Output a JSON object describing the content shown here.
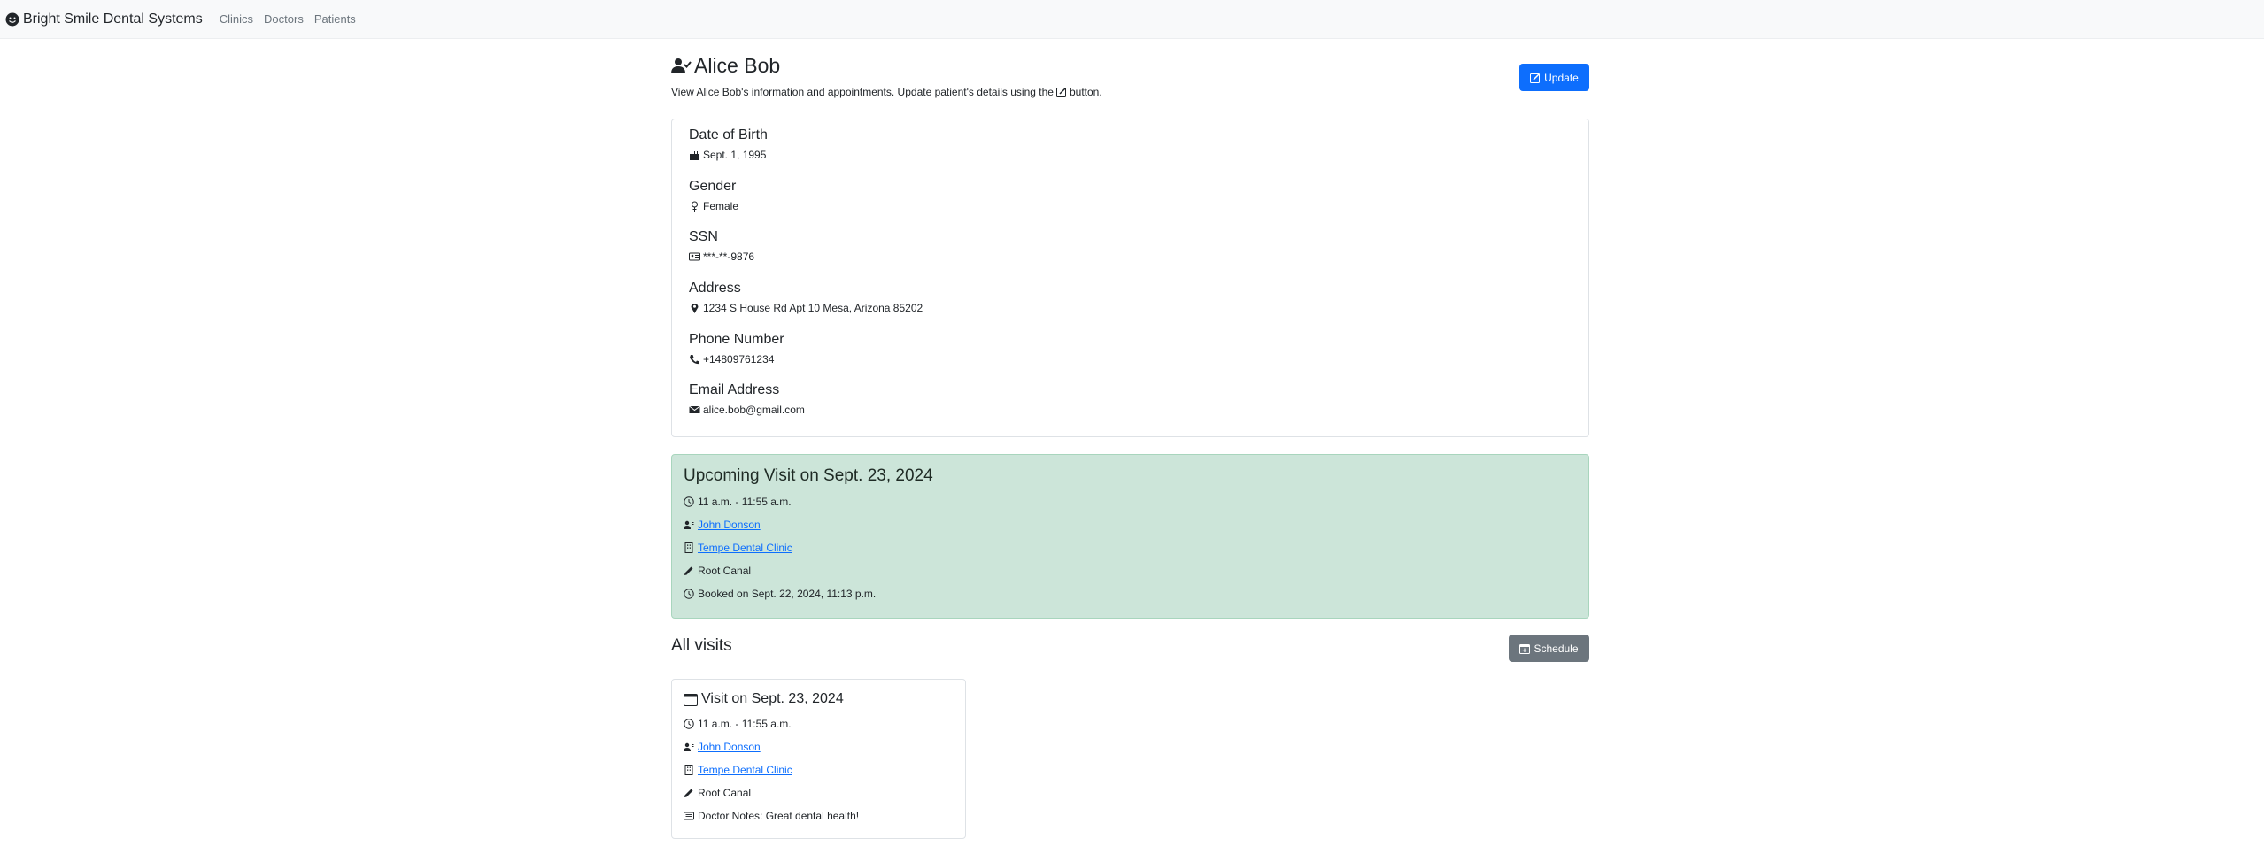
{
  "navbar": {
    "brand": "Bright Smile Dental Systems",
    "brand_icon": "smile-icon",
    "links": [
      "Clinics",
      "Doctors",
      "Patients"
    ]
  },
  "header": {
    "title": "Alice Bob",
    "title_icon": "person-check-icon",
    "subtitle_before": "View Alice Bob's information and appointments. Update patient's details using the",
    "subtitle_after": "button.",
    "update_label": "Update"
  },
  "details": [
    {
      "label": "Date of Birth",
      "value": "Sept. 1, 1995",
      "icon": "cake-icon"
    },
    {
      "label": "Gender",
      "value": "Female",
      "icon": "gender-female-icon"
    },
    {
      "label": "SSN",
      "value": "***-**-9876",
      "icon": "person-vcard-icon"
    },
    {
      "label": "Address",
      "value": "1234 S House Rd Apt 10 Mesa, Arizona 85202",
      "icon": "geo-pin-icon"
    },
    {
      "label": "Phone Number",
      "value": "+14809761234",
      "icon": "telephone-icon"
    },
    {
      "label": "Email Address",
      "value": "alice.bob@gmail.com",
      "icon": "envelope-icon"
    }
  ],
  "upcoming": {
    "title": "Upcoming Visit on Sept. 23, 2024",
    "time": "11 a.m. - 11:55 a.m.",
    "doctor": "John Donson",
    "clinic": "Tempe Dental Clinic",
    "procedure": "Root Canal",
    "booked": "Booked on Sept. 22, 2024, 11:13 p.m."
  },
  "all_visits": {
    "heading": "All visits",
    "schedule_label": "Schedule",
    "visits": [
      {
        "title": "Visit on Sept. 23, 2024",
        "time": "11 a.m. - 11:55 a.m.",
        "doctor": "John Donson",
        "clinic": "Tempe Dental Clinic",
        "procedure": "Root Canal",
        "notes": "Doctor Notes: Great dental health!"
      }
    ]
  },
  "colors": {
    "primary": "#0d6efd",
    "secondary": "#6c757d",
    "upcoming_bg": "#cce5d9"
  }
}
